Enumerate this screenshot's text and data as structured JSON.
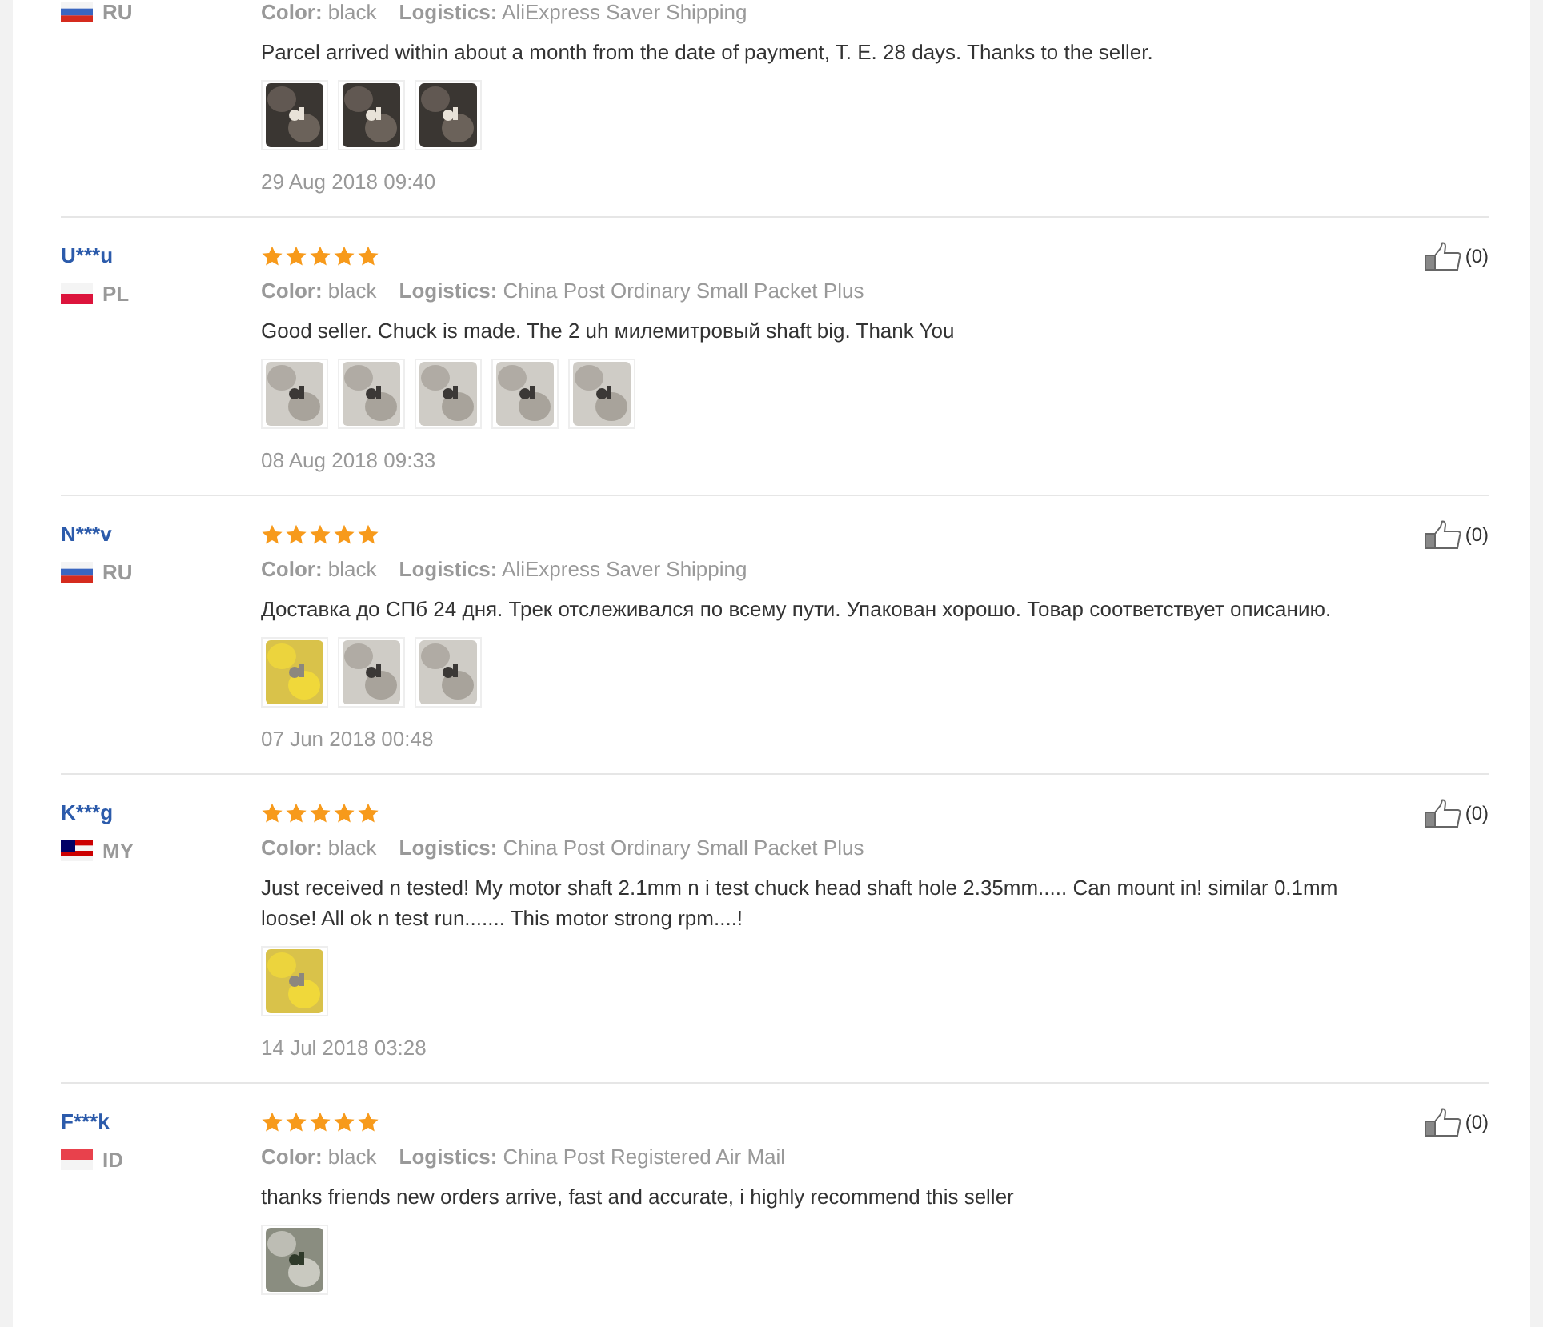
{
  "reviews": [
    {
      "country": "RU",
      "flag": {
        "kind": "tricolor"
      },
      "color_label": "Color:",
      "color_value": "black",
      "logistics_label": "Logistics:",
      "logistics": "AliExpress Saver Shipping",
      "text": "Parcel arrived within about a month from the date of payment, T. E. 28 days. Thanks to the seller.",
      "photos": [
        {
          "kind": "picture"
        },
        {
          "kind": "picture"
        },
        {
          "kind": "picture"
        }
      ],
      "date": "29 Aug 2018 09:40"
    },
    {
      "user": "U***u",
      "country": "PL",
      "flag": {
        "kind": "bicolor"
      },
      "stars": 5,
      "helpful": "(0)",
      "color_label": "Color:",
      "color_value": "black",
      "logistics_label": "Logistics:",
      "logistics": "China Post Ordinary Small Packet Plus",
      "text": "Good seller. Chuck is made. The 2 uh милемитровый shaft big. Thank You",
      "photos": [
        {
          "kind": "picture"
        },
        {
          "kind": "picture"
        },
        {
          "kind": "picture"
        },
        {
          "kind": "picture"
        },
        {
          "kind": "picture"
        }
      ],
      "date": "08 Aug 2018 09:33"
    },
    {
      "user": "N***v",
      "country": "RU",
      "flag": {
        "kind": "tricolor"
      },
      "stars": 5,
      "helpful": "(0)",
      "color_label": "Color:",
      "color_value": "black",
      "logistics_label": "Logistics:",
      "logistics": "AliExpress Saver Shipping",
      "text": "Доставка до СПб 24 дня. Трек отслеживался по всему пути. Упакован хорошо. Товар соответствует описанию.",
      "photos": [
        {
          "kind": "picture"
        },
        {
          "kind": "picture"
        },
        {
          "kind": "picture"
        }
      ],
      "date": "07 Jun 2018 00:48"
    },
    {
      "user": "K***g",
      "country": "MY",
      "flag": {
        "kind": "striped"
      },
      "stars": 5,
      "helpful": "(0)",
      "color_label": "Color:",
      "color_value": "black",
      "logistics_label": "Logistics:",
      "logistics": "China Post Ordinary Small Packet Plus",
      "text": "Just received n tested! My motor shaft 2.1mm n i test chuck head shaft hole 2.35mm..... Can mount in! similar 0.1mm loose! All ok n test run....... This motor strong rpm....!",
      "photos": [
        {
          "kind": "picture"
        }
      ],
      "date": "14 Jul 2018 03:28"
    },
    {
      "user": "F***k",
      "country": "ID",
      "flag": {
        "kind": "bicolor-inverse"
      },
      "stars": 5,
      "helpful": "(0)",
      "color_label": "Color:",
      "color_value": "black",
      "logistics_label": "Logistics:",
      "logistics": "China Post Registered Air Mail",
      "text": "thanks friends new orders arrive, fast and accurate, i highly recommend this seller",
      "photos": [
        {
          "kind": "picture"
        }
      ]
    }
  ]
}
